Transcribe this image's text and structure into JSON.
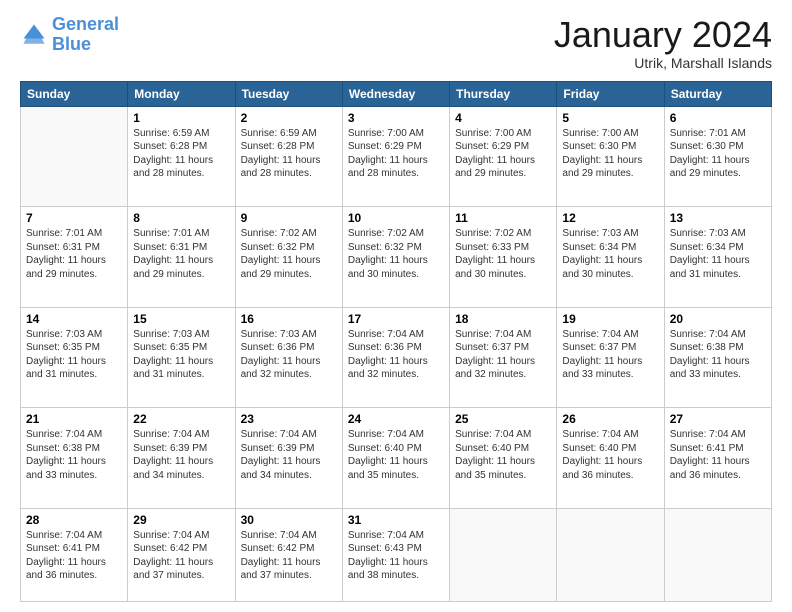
{
  "header": {
    "logo_line1": "General",
    "logo_line2": "Blue",
    "month": "January 2024",
    "location": "Utrik, Marshall Islands"
  },
  "days_of_week": [
    "Sunday",
    "Monday",
    "Tuesday",
    "Wednesday",
    "Thursday",
    "Friday",
    "Saturday"
  ],
  "weeks": [
    [
      {
        "day": "",
        "info": ""
      },
      {
        "day": "1",
        "info": "Sunrise: 6:59 AM\nSunset: 6:28 PM\nDaylight: 11 hours\nand 28 minutes."
      },
      {
        "day": "2",
        "info": "Sunrise: 6:59 AM\nSunset: 6:28 PM\nDaylight: 11 hours\nand 28 minutes."
      },
      {
        "day": "3",
        "info": "Sunrise: 7:00 AM\nSunset: 6:29 PM\nDaylight: 11 hours\nand 28 minutes."
      },
      {
        "day": "4",
        "info": "Sunrise: 7:00 AM\nSunset: 6:29 PM\nDaylight: 11 hours\nand 29 minutes."
      },
      {
        "day": "5",
        "info": "Sunrise: 7:00 AM\nSunset: 6:30 PM\nDaylight: 11 hours\nand 29 minutes."
      },
      {
        "day": "6",
        "info": "Sunrise: 7:01 AM\nSunset: 6:30 PM\nDaylight: 11 hours\nand 29 minutes."
      }
    ],
    [
      {
        "day": "7",
        "info": "Sunrise: 7:01 AM\nSunset: 6:31 PM\nDaylight: 11 hours\nand 29 minutes."
      },
      {
        "day": "8",
        "info": "Sunrise: 7:01 AM\nSunset: 6:31 PM\nDaylight: 11 hours\nand 29 minutes."
      },
      {
        "day": "9",
        "info": "Sunrise: 7:02 AM\nSunset: 6:32 PM\nDaylight: 11 hours\nand 29 minutes."
      },
      {
        "day": "10",
        "info": "Sunrise: 7:02 AM\nSunset: 6:32 PM\nDaylight: 11 hours\nand 30 minutes."
      },
      {
        "day": "11",
        "info": "Sunrise: 7:02 AM\nSunset: 6:33 PM\nDaylight: 11 hours\nand 30 minutes."
      },
      {
        "day": "12",
        "info": "Sunrise: 7:03 AM\nSunset: 6:34 PM\nDaylight: 11 hours\nand 30 minutes."
      },
      {
        "day": "13",
        "info": "Sunrise: 7:03 AM\nSunset: 6:34 PM\nDaylight: 11 hours\nand 31 minutes."
      }
    ],
    [
      {
        "day": "14",
        "info": "Sunrise: 7:03 AM\nSunset: 6:35 PM\nDaylight: 11 hours\nand 31 minutes."
      },
      {
        "day": "15",
        "info": "Sunrise: 7:03 AM\nSunset: 6:35 PM\nDaylight: 11 hours\nand 31 minutes."
      },
      {
        "day": "16",
        "info": "Sunrise: 7:03 AM\nSunset: 6:36 PM\nDaylight: 11 hours\nand 32 minutes."
      },
      {
        "day": "17",
        "info": "Sunrise: 7:04 AM\nSunset: 6:36 PM\nDaylight: 11 hours\nand 32 minutes."
      },
      {
        "day": "18",
        "info": "Sunrise: 7:04 AM\nSunset: 6:37 PM\nDaylight: 11 hours\nand 32 minutes."
      },
      {
        "day": "19",
        "info": "Sunrise: 7:04 AM\nSunset: 6:37 PM\nDaylight: 11 hours\nand 33 minutes."
      },
      {
        "day": "20",
        "info": "Sunrise: 7:04 AM\nSunset: 6:38 PM\nDaylight: 11 hours\nand 33 minutes."
      }
    ],
    [
      {
        "day": "21",
        "info": "Sunrise: 7:04 AM\nSunset: 6:38 PM\nDaylight: 11 hours\nand 33 minutes."
      },
      {
        "day": "22",
        "info": "Sunrise: 7:04 AM\nSunset: 6:39 PM\nDaylight: 11 hours\nand 34 minutes."
      },
      {
        "day": "23",
        "info": "Sunrise: 7:04 AM\nSunset: 6:39 PM\nDaylight: 11 hours\nand 34 minutes."
      },
      {
        "day": "24",
        "info": "Sunrise: 7:04 AM\nSunset: 6:40 PM\nDaylight: 11 hours\nand 35 minutes."
      },
      {
        "day": "25",
        "info": "Sunrise: 7:04 AM\nSunset: 6:40 PM\nDaylight: 11 hours\nand 35 minutes."
      },
      {
        "day": "26",
        "info": "Sunrise: 7:04 AM\nSunset: 6:40 PM\nDaylight: 11 hours\nand 36 minutes."
      },
      {
        "day": "27",
        "info": "Sunrise: 7:04 AM\nSunset: 6:41 PM\nDaylight: 11 hours\nand 36 minutes."
      }
    ],
    [
      {
        "day": "28",
        "info": "Sunrise: 7:04 AM\nSunset: 6:41 PM\nDaylight: 11 hours\nand 36 minutes."
      },
      {
        "day": "29",
        "info": "Sunrise: 7:04 AM\nSunset: 6:42 PM\nDaylight: 11 hours\nand 37 minutes."
      },
      {
        "day": "30",
        "info": "Sunrise: 7:04 AM\nSunset: 6:42 PM\nDaylight: 11 hours\nand 37 minutes."
      },
      {
        "day": "31",
        "info": "Sunrise: 7:04 AM\nSunset: 6:43 PM\nDaylight: 11 hours\nand 38 minutes."
      },
      {
        "day": "",
        "info": ""
      },
      {
        "day": "",
        "info": ""
      },
      {
        "day": "",
        "info": ""
      }
    ]
  ]
}
